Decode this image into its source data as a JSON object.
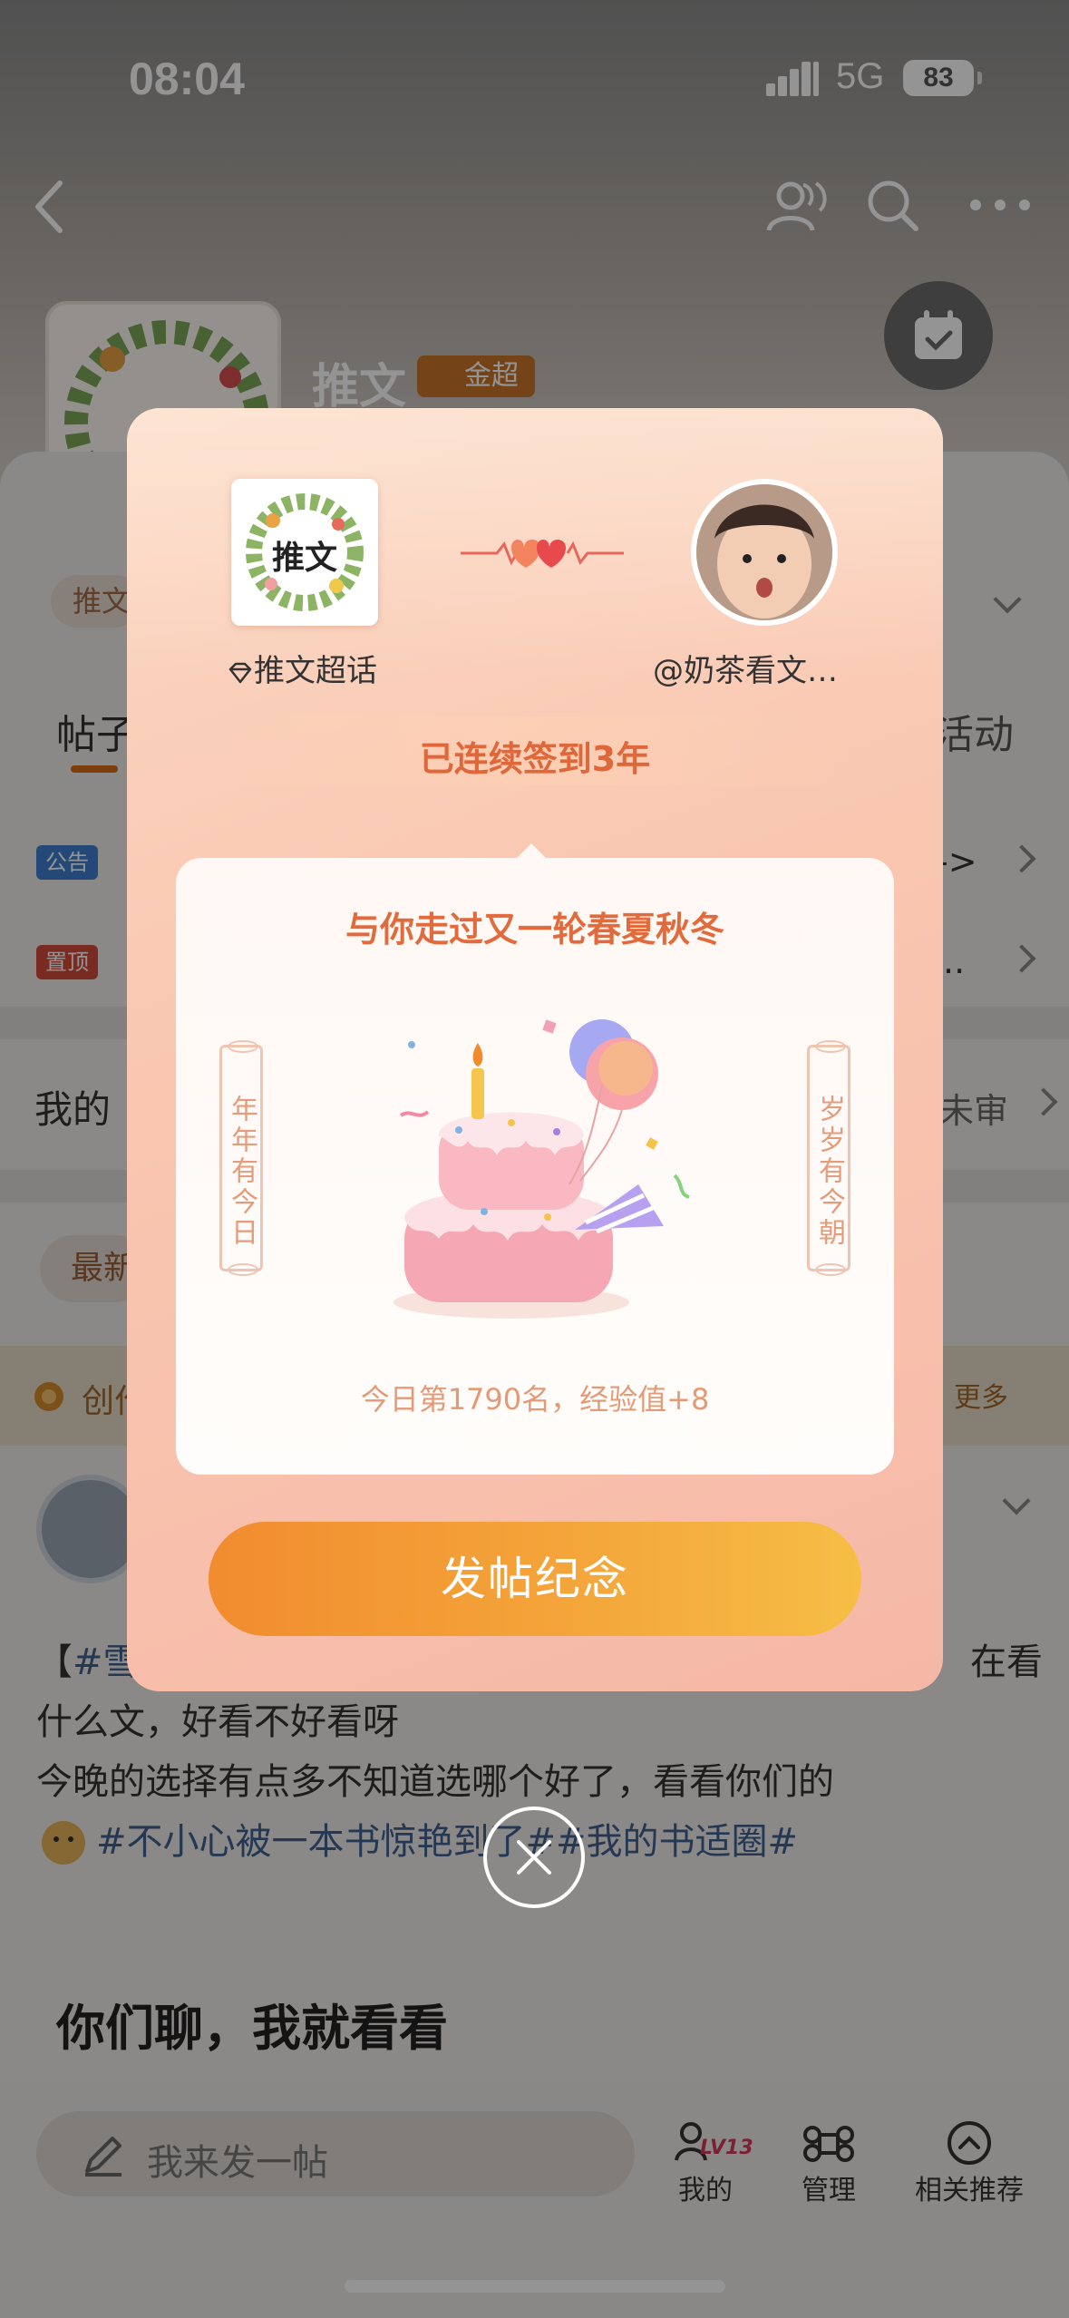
{
  "status": {
    "time": "08:04",
    "network": "5G",
    "battery": "83"
  },
  "background": {
    "topic_name": "推文",
    "topic_badge": "金超",
    "cover_text": "推文",
    "tag_label": "推文",
    "tab_posts": "帖子",
    "tab_activity": "活动",
    "announce_badge": "公告",
    "pinned_badge": "置顶",
    "announce_tail": "->",
    "pinned_tail": "..",
    "my_row": "我的",
    "unreviewed": "未审",
    "latest_pill": "最新",
    "creator_label": "创作",
    "more_link": "更多",
    "post_line1_tag": "#雪",
    "post_line1_tail": "在看",
    "post_line2": "什么文，好看不好看呀",
    "post_line3": "今晚的选择有点多不知道选哪个好了，看看你们的",
    "post_line4": "#不小心被一本书惊艳到了##我的书适圈#",
    "post_title": "你们聊，我就看看",
    "compose_placeholder": "我来发一帖",
    "nav_mine": "我的",
    "nav_level": "LV13",
    "nav_manage": "管理",
    "nav_related": "相关推荐"
  },
  "modal": {
    "topic_image_text": "推文",
    "topic_label": "推文超话",
    "user_label": "@奶茶看文…",
    "streak_text": "已连续签到3年",
    "card_title": "与你走过又一轮春夏秋冬",
    "left_scroll": "年年有今日",
    "right_scroll": "岁岁有今朝",
    "rank_text": "今日第1790名，经验值+8",
    "cta_label": "发帖纪念"
  },
  "colors": {
    "accent_orange": "#e16b3c",
    "cta_start": "#f18c2f",
    "cta_end": "#f6be45",
    "hashtag_blue": "#3e5f8f"
  }
}
